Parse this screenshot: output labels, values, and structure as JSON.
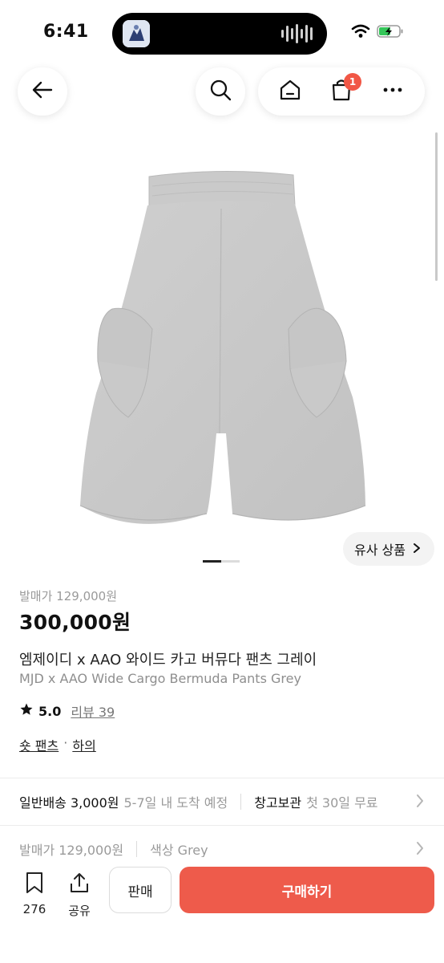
{
  "status": {
    "time": "6:41"
  },
  "header": {
    "cart_badge": "1"
  },
  "similar": {
    "label": "유사 상품"
  },
  "product": {
    "release_price_label": "발매가 129,000원",
    "price": "300,000원",
    "title_ko": "엠제이디 x AAO 와이드 카고 버뮤다 팬츠 그레이",
    "title_en": "MJD x AAO Wide Cargo Bermuda Pants Grey",
    "rating": "5.0",
    "reviews": "리뷰 39",
    "category_1": "숏 팬츠",
    "category_sep": "·",
    "category_2": "하의"
  },
  "shipping": {
    "standard_label": "일반배송 3,000원",
    "standard_eta": "5-7일 내 도착 예정",
    "storage_label": "창고보관",
    "storage_note": "첫 30일 무료"
  },
  "options": {
    "release_price": "발매가 129,000원",
    "color": "색상 Grey"
  },
  "bottom": {
    "bookmark_count": "276",
    "share_label": "공유",
    "sell_label": "판매",
    "buy_label": "구매하기"
  },
  "colors": {
    "accent": "#ee5b4b",
    "badge": "#f15746"
  },
  "image": {
    "alt": "grey wide cargo bermuda shorts"
  }
}
